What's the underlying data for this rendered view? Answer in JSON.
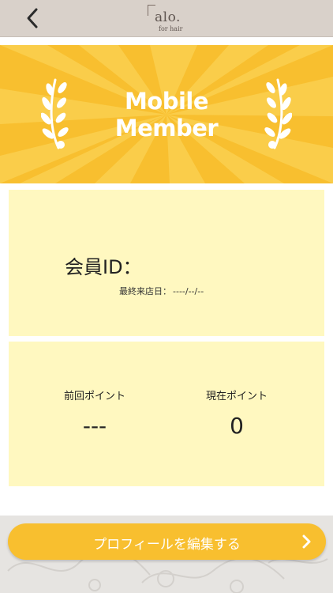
{
  "header": {
    "back_icon": "chevron-left-icon",
    "logo_name": "alo.",
    "logo_sub": "for hair"
  },
  "banner": {
    "line1": "Mobile",
    "line2": "Member",
    "background_color": "#f8bf2f"
  },
  "member": {
    "id_label": "会員ID：",
    "id_value": "",
    "last_visit_label": "最終来店日：",
    "last_visit_value": "----/--/--"
  },
  "points": {
    "previous_label": "前回ポイント",
    "previous_value": "---",
    "current_label": "現在ポイント",
    "current_value": "0"
  },
  "actions": {
    "edit_profile_label": "プロフィールを編集する",
    "edit_profile_icon": "chevron-right-icon"
  },
  "colors": {
    "accent": "#f8bf2f",
    "card_bg": "#fff8c0",
    "header_bg": "#d9d1ca"
  }
}
